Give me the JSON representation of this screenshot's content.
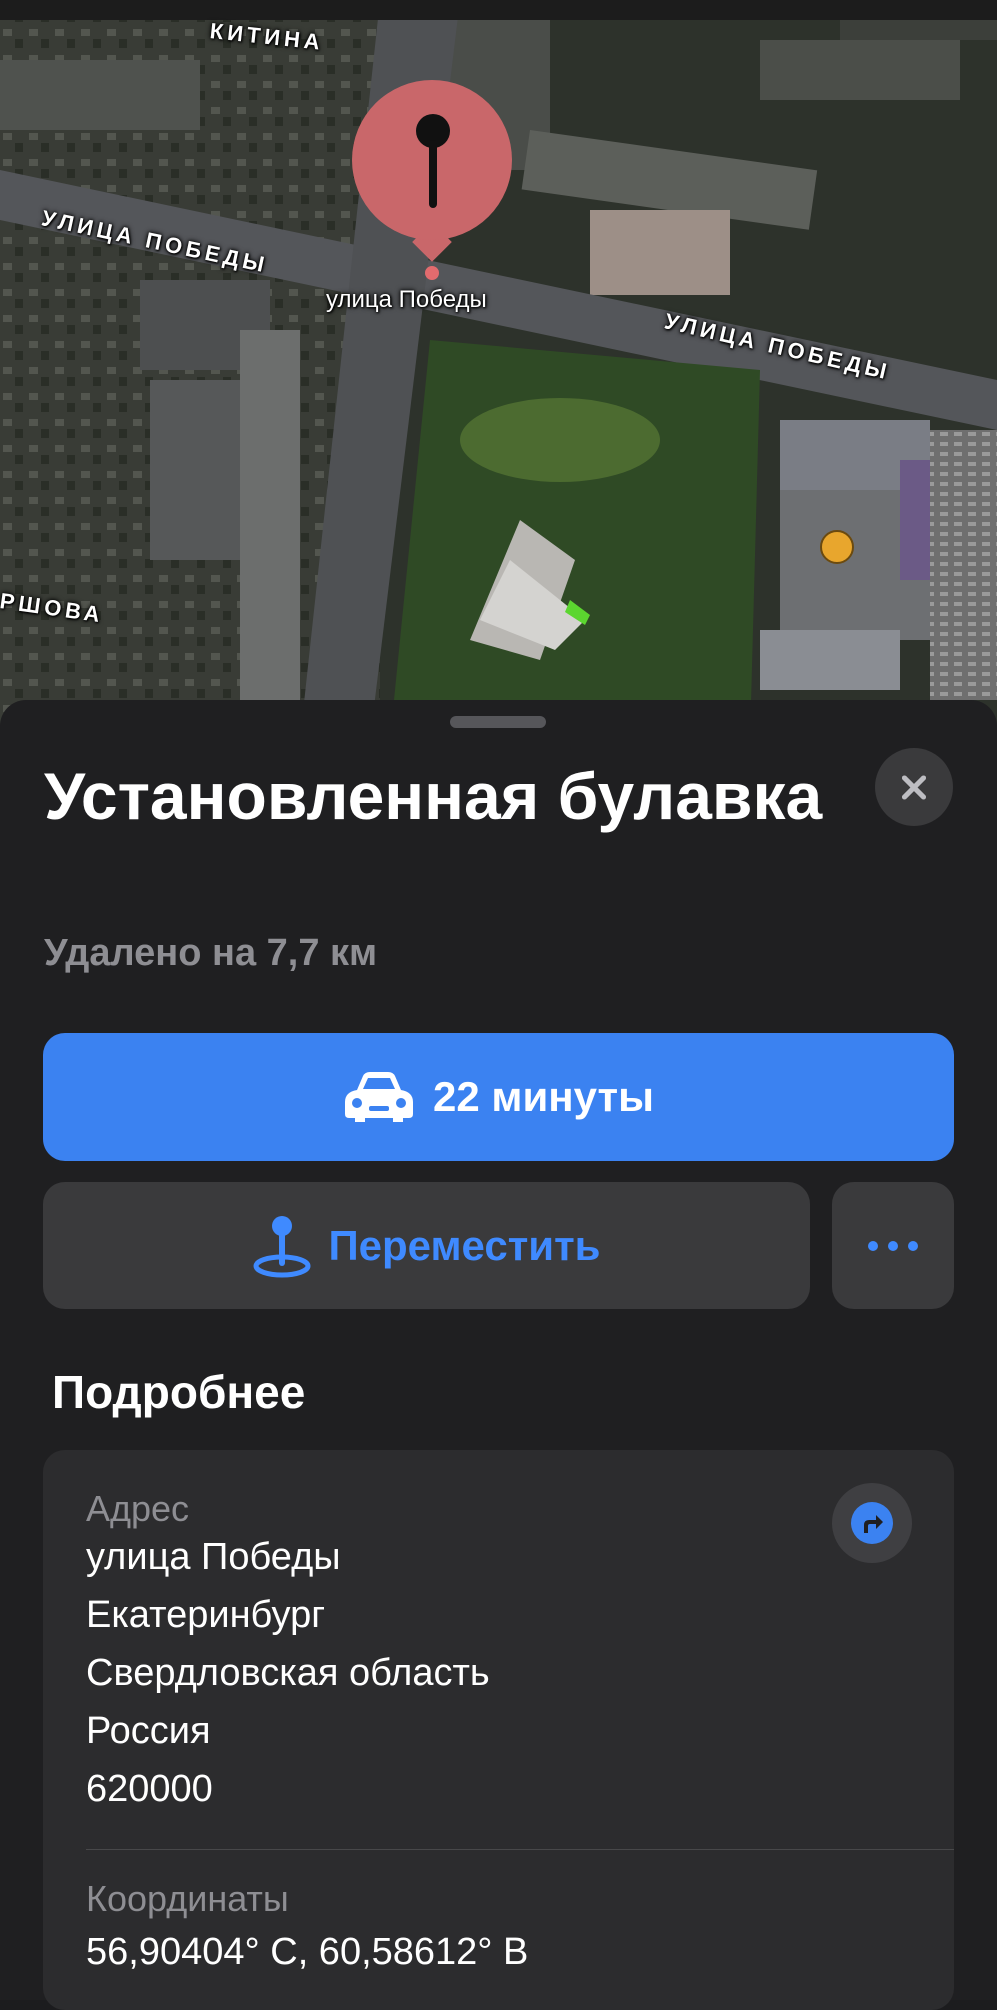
{
  "map": {
    "street_labels": {
      "top": "КИТИНА",
      "left": "УЛИЦА ПОБЕДЫ",
      "right": "УЛИЦА ПОБЕДЫ",
      "pin_label": "улица Победы",
      "left_edge": "РШОВА"
    },
    "pin_icon": "map-pin-icon",
    "poi_icon": "shopping-bag-icon",
    "colors": {
      "pin": "#c9676a"
    }
  },
  "sheet": {
    "title": "Установленная булавка",
    "subtitle": "Удалено на 7,7 км",
    "drive_button": {
      "icon": "car-icon",
      "label": "22 минуты"
    },
    "move_button": {
      "icon": "pin-move-icon",
      "label": "Переместить"
    },
    "more_button": {
      "icon": "ellipsis-icon"
    },
    "section_title": "Подробнее",
    "address": {
      "label": "Адрес",
      "lines": [
        "улица Победы",
        "Екатеринбург",
        "Свердловская область",
        "Россия",
        "620000"
      ]
    },
    "coordinates": {
      "label": "Координаты",
      "value": "56,90404° С, 60,58612° В"
    },
    "colors": {
      "accent": "#3b82f1",
      "background": "#1f1f21",
      "card": "#2c2c2e"
    }
  }
}
